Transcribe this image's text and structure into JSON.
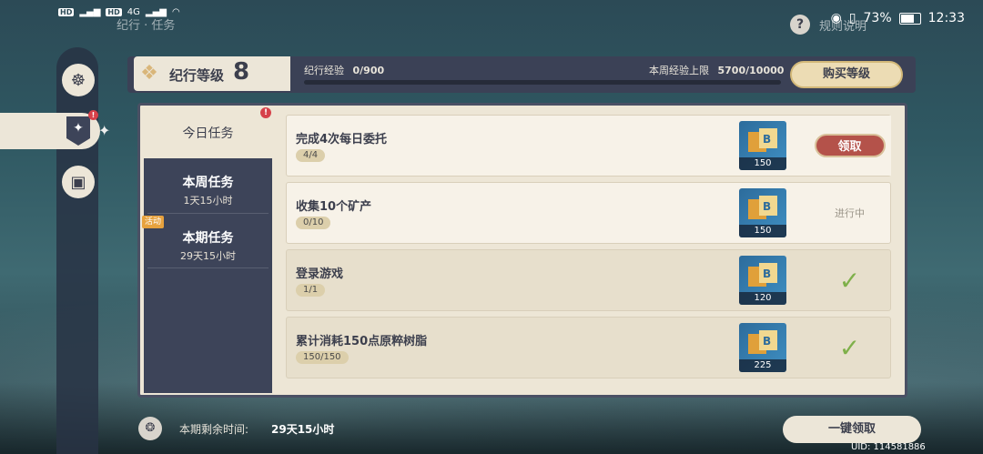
{
  "status_bar": {
    "network_labels": [
      "HD",
      "HD",
      "4G",
      "4G"
    ],
    "battery": "73%",
    "time": "12:33"
  },
  "header": {
    "title": "纪行 · 任务",
    "help_icon": "?",
    "rules_label": "规则说明"
  },
  "level": {
    "label": "纪行等级",
    "value": "8",
    "exp_label": "纪行经验",
    "exp_value": "0/900",
    "exp_progress": 0.0,
    "weekly_cap_label": "本周经验上限",
    "weekly_cap_value": "5700/10000",
    "buy_label": "购买等级"
  },
  "tabs": [
    {
      "label": "今日任务",
      "sub": "",
      "active": true,
      "badge": "!"
    },
    {
      "label": "本周任务",
      "sub": "1天15小时",
      "active": false
    },
    {
      "label": "本期任务",
      "sub": "29天15小时",
      "active": false,
      "tag": "活动"
    }
  ],
  "tasks": [
    {
      "title": "完成4次每日委托",
      "progress": "4/4",
      "reward_qty": "150",
      "status": "claim",
      "action_label": "领取"
    },
    {
      "title": "收集10个矿产",
      "progress": "0/10",
      "reward_qty": "150",
      "status": "in_progress",
      "action_label": "进行中"
    },
    {
      "title": "登录游戏",
      "progress": "1/1",
      "reward_qty": "120",
      "status": "done",
      "action_label": "✓"
    },
    {
      "title": "累计消耗150点原粹树脂",
      "progress": "150/150",
      "reward_qty": "225",
      "status": "done",
      "action_label": "✓"
    }
  ],
  "footer": {
    "remaining_label": "本期剩余时间:",
    "remaining_value": "29天15小时",
    "claim_all_label": "一键领取",
    "uid": "UID: 114581886"
  },
  "colors": {
    "panel": "#ede6d6",
    "dark_navy": "#3d4459",
    "accent_gold": "#e7c37e",
    "claim_red": "#b4524a",
    "check_green": "#7fb04a"
  }
}
